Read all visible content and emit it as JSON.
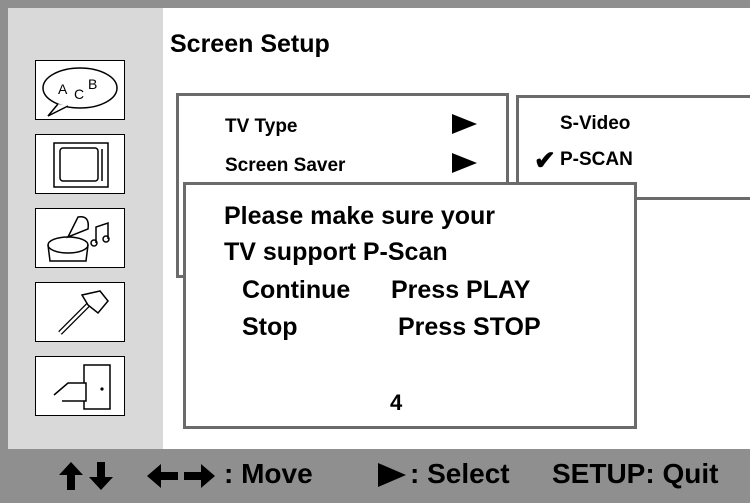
{
  "title": "Screen Setup",
  "menu": {
    "items": [
      {
        "label": "TV Type"
      },
      {
        "label": "Screen Saver"
      }
    ]
  },
  "options": {
    "items": [
      {
        "label": "S-Video",
        "checked": false
      },
      {
        "label": "P-SCAN",
        "checked": true
      }
    ],
    "check_mark": "✔"
  },
  "dialog": {
    "line1": "Please make sure your",
    "line2": "TV support P-Scan",
    "continue_label": "Continue",
    "continue_action": "Press PLAY",
    "stop_label": "Stop",
    "stop_action": "Press STOP",
    "countdown": "4"
  },
  "sidebar": {
    "icons": [
      "language-icon",
      "tv-screen-icon",
      "audio-icon",
      "tools-icon",
      "exit-door-icon"
    ]
  },
  "help": {
    "move_label": ": Move",
    "select_label": ": Select",
    "quit_label": "SETUP: Quit"
  },
  "colors": {
    "border": "#8f8f8f",
    "sidebar": "#d9d9d9",
    "box_border": "#6b6b6b"
  }
}
